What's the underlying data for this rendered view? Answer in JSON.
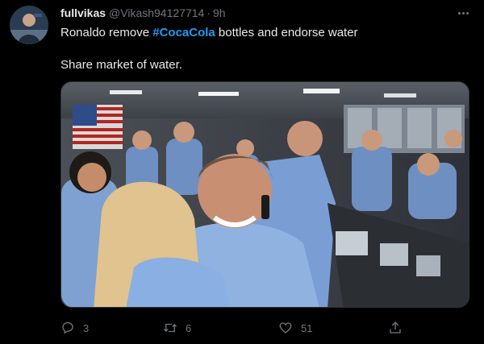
{
  "author": {
    "display_name": "fullvikas",
    "handle": "@Vikash94127714",
    "separator": "·",
    "time": "9h"
  },
  "tweet": {
    "text_prefix": "Ronaldo remove ",
    "hashtag": "#CocaCola",
    "text_suffix": " bottles and endorse water",
    "line2": "Share market of water."
  },
  "actions": {
    "replies": "3",
    "retweets": "6",
    "likes": "51"
  },
  "icons": {
    "avatar": "user-avatar",
    "more": "more-horizontal-icon",
    "reply": "reply-icon",
    "retweet": "retweet-icon",
    "like": "heart-icon",
    "share": "share-icon"
  },
  "colors": {
    "background": "#000000",
    "text": "#e7e9ea",
    "muted": "#71767b",
    "hashtag": "#1d9bf0"
  }
}
